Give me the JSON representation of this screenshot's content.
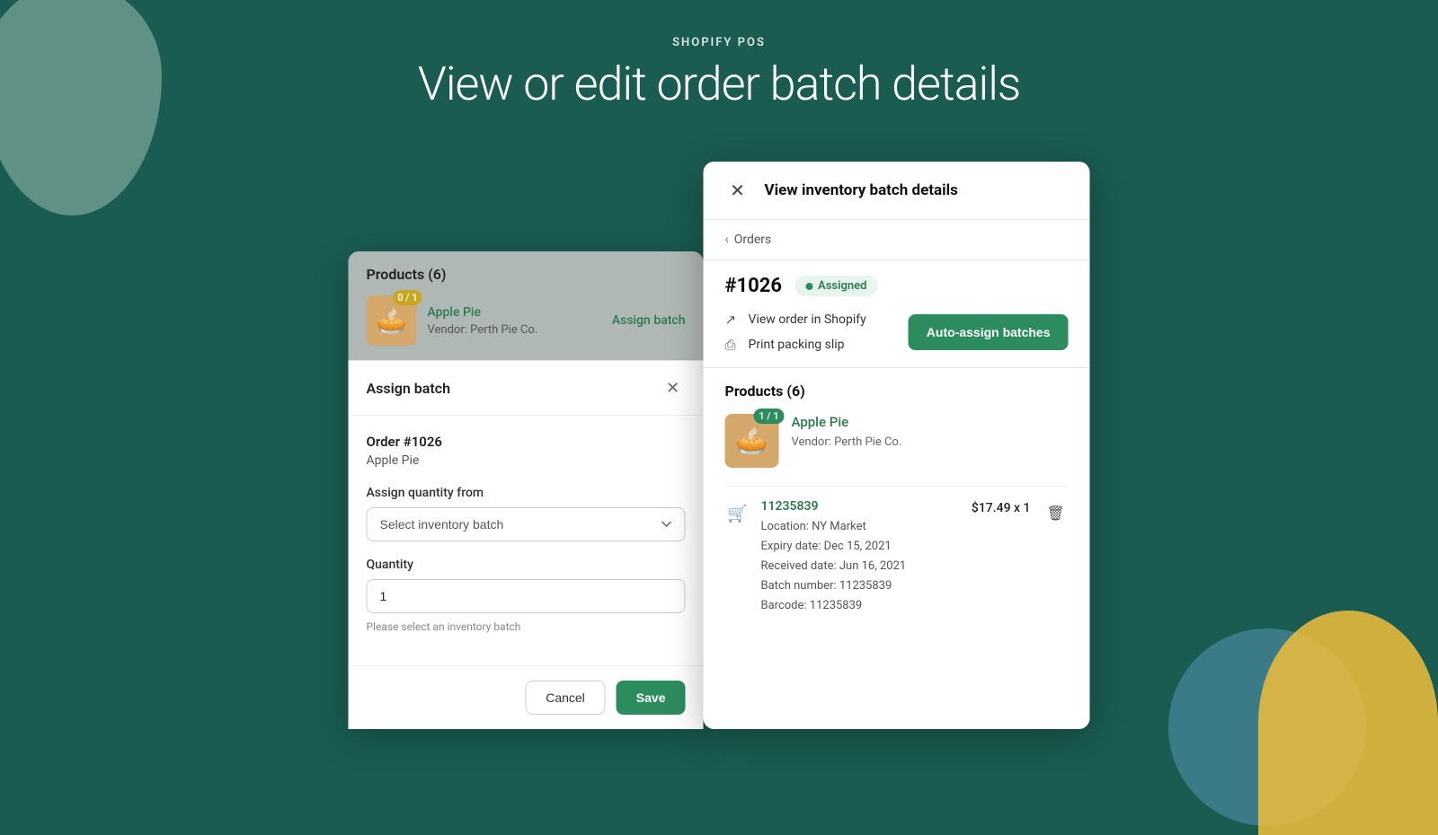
{
  "page": {
    "background_color": "#1a5c52",
    "subtitle": "SHOPIFY POS",
    "title": "View or edit order batch details"
  },
  "left_panel": {
    "products_title": "Products (6)",
    "product": {
      "badge": "0 / 1",
      "name": "Apple Pie",
      "vendor": "Vendor: Perth Pie Co.",
      "assign_link": "Assign batch"
    },
    "assign_dialog": {
      "title": "Assign batch",
      "order_title": "Order #1026",
      "order_product": "Apple Pie",
      "assign_qty_label": "Assign quantity from",
      "select_placeholder": "Select inventory batch",
      "quantity_label": "Quantity",
      "quantity_value": "1",
      "helper_text": "Please select an inventory batch",
      "cancel_label": "Cancel",
      "save_label": "Save"
    }
  },
  "right_panel": {
    "header_title": "View inventory batch details",
    "back_label": "Orders",
    "order_number": "#1026",
    "status_badge": "Assigned",
    "view_order_label": "View order in Shopify",
    "print_label": "Print packing slip",
    "auto_assign_label": "Auto-assign batches",
    "products_title": "Products (6)",
    "product": {
      "badge": "1 / 1",
      "name": "Apple Pie",
      "vendor": "Vendor: Perth Pie Co."
    },
    "batch": {
      "number": "11235839",
      "price": "$17.49 x 1",
      "location": "Location: NY Market",
      "expiry": "Expiry date: Dec 15, 2021",
      "received": "Received date: Jun 16, 2021",
      "batch_number_label": "Batch number: 11235839",
      "barcode": "Barcode: 11235839"
    }
  }
}
